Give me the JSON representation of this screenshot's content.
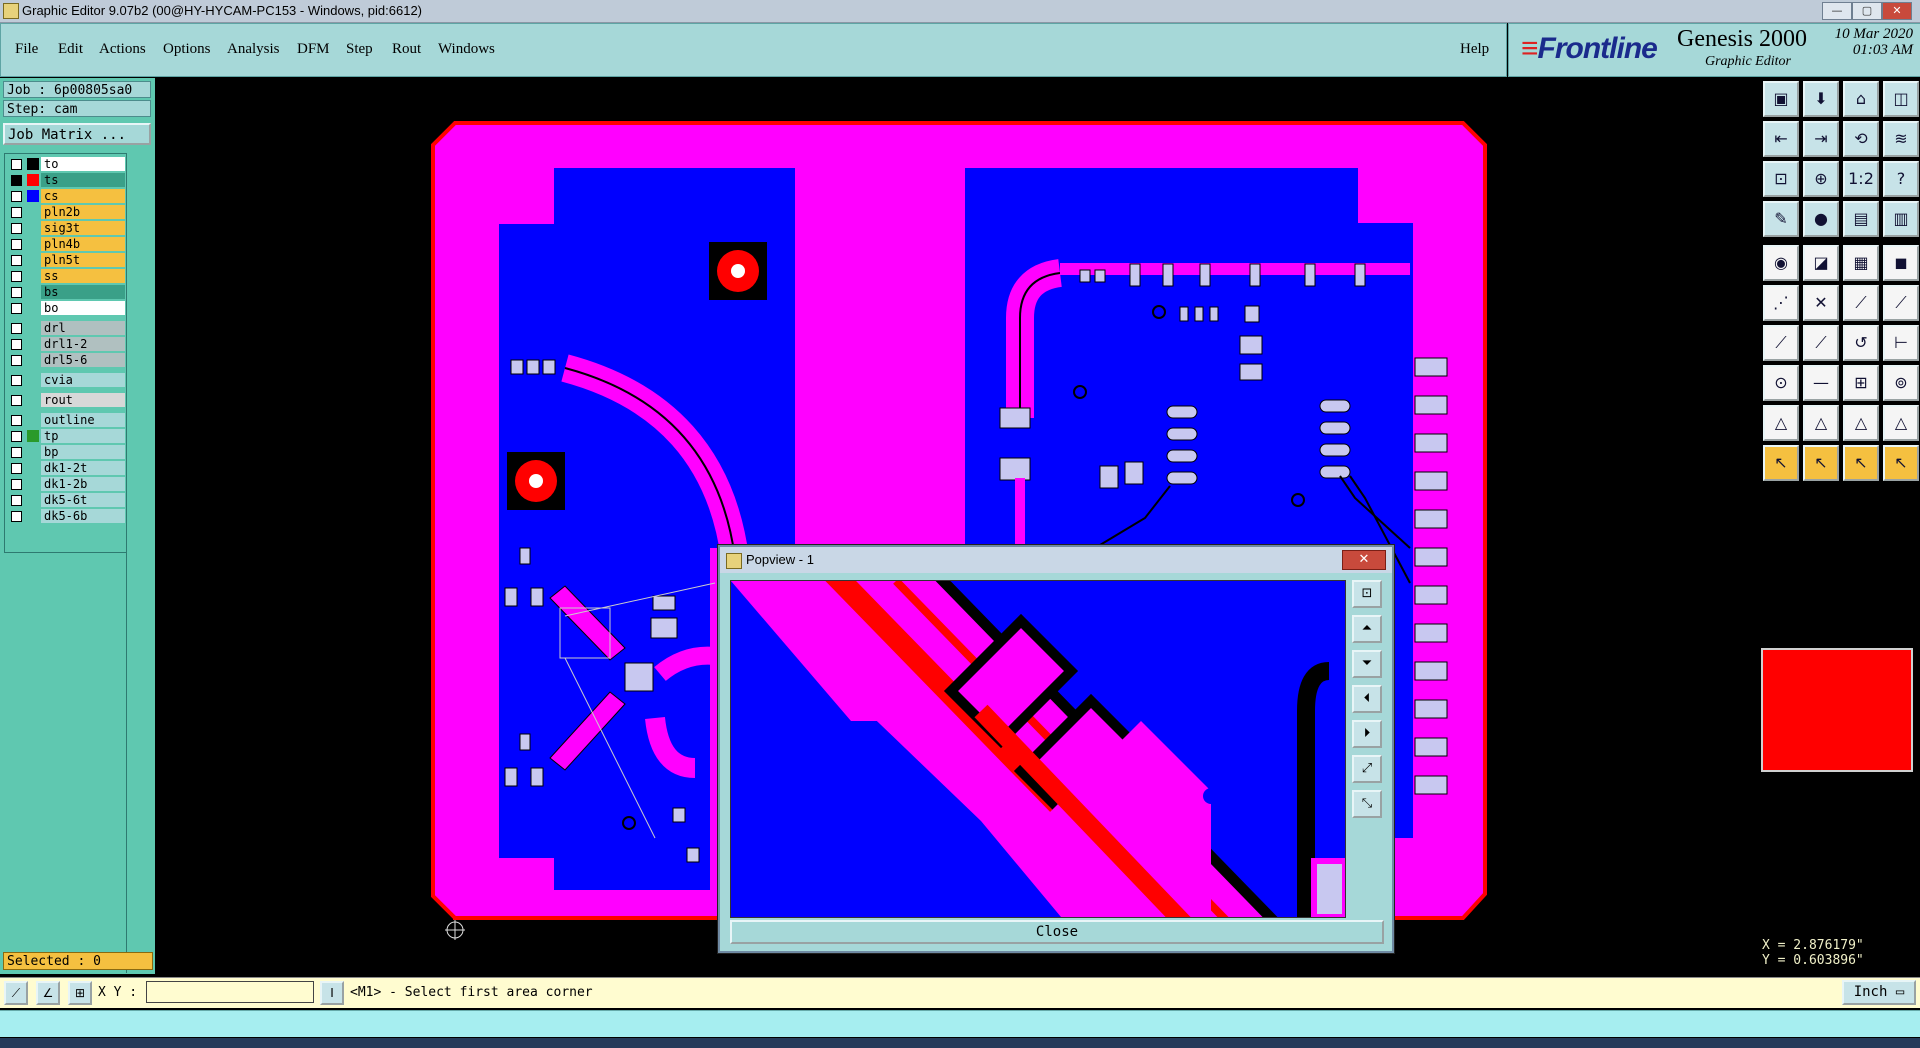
{
  "window": {
    "title": "Graphic Editor 9.07b2 (00@HY-HYCAM-PC153 - Windows, pid:6612)",
    "min": "—",
    "max": "▢",
    "close": "✕"
  },
  "menu": {
    "items": [
      "File",
      "Edit",
      "Actions",
      "Options",
      "Analysis",
      "DFM",
      "Step",
      "Rout",
      "Windows"
    ],
    "help": "Help"
  },
  "brand": {
    "logo": "Frontline",
    "product": "Genesis 2000",
    "sub": "Graphic Editor",
    "date": "10 Mar 2020",
    "time": "01:03 AM"
  },
  "job": {
    "job_label": "Job : 6p00805sa0",
    "step_label": "Step: cam",
    "matrix_button": "Job Matrix ..."
  },
  "layers": [
    {
      "name": "to",
      "swatch": "#000000",
      "bg": "#ffffff"
    },
    {
      "name": "ts",
      "swatch": "#ff0000",
      "bg": "#3aa088",
      "active": true
    },
    {
      "name": "cs",
      "swatch": "#0000ff",
      "bg": "#f5c040"
    },
    {
      "name": "pln2b",
      "swatch": "",
      "bg": "#f5c040"
    },
    {
      "name": "sig3t",
      "swatch": "",
      "bg": "#f5c040"
    },
    {
      "name": "pln4b",
      "swatch": "",
      "bg": "#f5c040"
    },
    {
      "name": "pln5t",
      "swatch": "",
      "bg": "#f5c040"
    },
    {
      "name": "ss",
      "swatch": "",
      "bg": "#f5c040"
    },
    {
      "name": "bs",
      "swatch": "",
      "bg": "#3aa088"
    },
    {
      "name": "bo",
      "swatch": "",
      "bg": "#ffffff"
    },
    {
      "name": "drl",
      "swatch": "",
      "bg": "#b0c0c0"
    },
    {
      "name": "drl1-2",
      "swatch": "",
      "bg": "#b0c0c0"
    },
    {
      "name": "drl5-6",
      "swatch": "",
      "bg": "#b0c0c0"
    },
    {
      "name": "cvia",
      "swatch": "",
      "bg": "#a6d8d8"
    },
    {
      "name": "rout",
      "swatch": "",
      "bg": "#d8d8d8"
    },
    {
      "name": "outline",
      "swatch": "",
      "bg": "#a6d8d8"
    },
    {
      "name": "tp",
      "swatch": "#2a9a2a",
      "bg": "#a6d8d8"
    },
    {
      "name": "bp",
      "swatch": "",
      "bg": "#a6d8d8"
    },
    {
      "name": "dk1-2t",
      "swatch": "",
      "bg": "#a6d8d8"
    },
    {
      "name": "dk1-2b",
      "swatch": "",
      "bg": "#a6d8d8"
    },
    {
      "name": "dk5-6t",
      "swatch": "",
      "bg": "#a6d8d8"
    },
    {
      "name": "dk5-6b",
      "swatch": "",
      "bg": "#a6d8d8"
    }
  ],
  "selected": "Selected : 0",
  "statusbar": {
    "xy_label": "X Y :",
    "xy_value": "",
    "prompt": "<M1> - Select first area corner",
    "unit": "Inch ▭"
  },
  "coords": {
    "x": "X = 2.876179\"",
    "y": "Y = 0.603896\""
  },
  "popview": {
    "title": "Popview - 1",
    "close_label": "Close",
    "closex": "✕"
  },
  "colors": {
    "copper_top": "#ff00ff",
    "plane": "#0000ff",
    "highlight": "#ff0000",
    "panel": "#a6d8d8"
  }
}
